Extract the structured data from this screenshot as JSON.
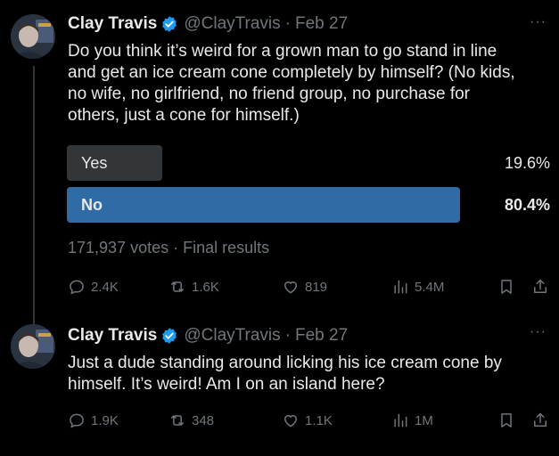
{
  "tweets": [
    {
      "author_name": "Clay Travis",
      "handle": "@ClayTravis",
      "date": "Feb 27",
      "more": "···",
      "text_lines": [
        "Do you think it’s weird for a grown man to go stand in line",
        "and get an ice cream cone completely by himself? (No kids,",
        "no wife, no girlfriend, no friend group, no purchase for",
        "others, just a cone for himself.)"
      ],
      "poll": {
        "options": [
          {
            "label": "Yes",
            "percent_text": "19.6%",
            "percent": 19.6
          },
          {
            "label": "No",
            "percent_text": "80.4%",
            "percent": 80.4
          }
        ],
        "meta": "171,937 votes · Final results"
      },
      "actions": {
        "replies": "2.4K",
        "reposts": "1.6K",
        "likes": "819",
        "views": "5.4M"
      }
    },
    {
      "author_name": "Clay Travis",
      "handle": "@ClayTravis",
      "date": "Feb 27",
      "more": "···",
      "text_lines": [
        "Just a dude standing around licking his ice cream cone by",
        "himself. It’s weird! Am I on an island here?"
      ],
      "actions": {
        "replies": "1.9K",
        "reposts": "348",
        "likes": "1.1K",
        "views": "1M"
      }
    }
  ],
  "colors": {
    "background": "#000000",
    "text": "#e7e9ea",
    "muted": "#71767b",
    "poll_winner": "#2f6ca6",
    "poll_other": "#333639",
    "verified": "#1d9bf0"
  }
}
